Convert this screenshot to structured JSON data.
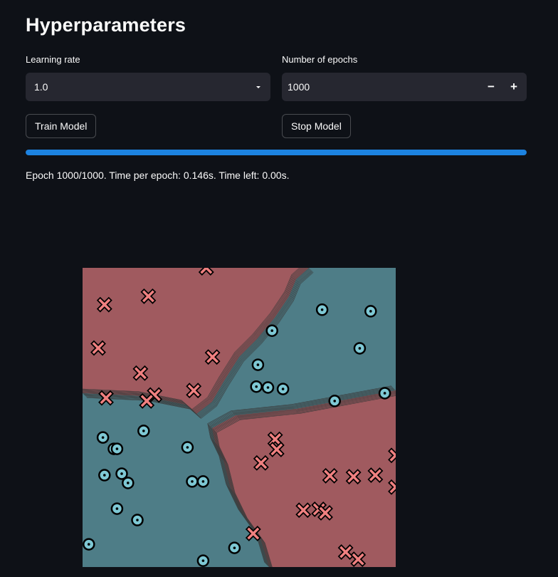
{
  "page": {
    "title": "Hyperparameters"
  },
  "controls": {
    "learning_rate": {
      "label": "Learning rate",
      "value": "1.0"
    },
    "epochs": {
      "label": "Number of epochs",
      "value": "1000",
      "decrement": "−",
      "increment": "+"
    },
    "train_button": "Train Model",
    "stop_button": "Stop Model"
  },
  "progress": {
    "fraction": 1.0
  },
  "status_text": "Epoch 1000/1000. Time per epoch: 0.146s. Time left: 0.00s.",
  "colors": {
    "background": "#0e1117",
    "widget": "#262730",
    "accent": "#1c83e1",
    "region_red": "#a05a5f",
    "region_teal": "#4e7d87",
    "marker_x": "#f08080",
    "marker_o": "#7ec8d4"
  },
  "chart_data": {
    "type": "scatter",
    "title": "",
    "xlabel": "",
    "ylabel": "",
    "xlim": [
      0,
      1
    ],
    "ylim": [
      0,
      1
    ],
    "grid": false,
    "legend": "none",
    "series": [
      {
        "marker": "x",
        "color": "#f08080",
        "points": [
          [
            0.395,
            1.0
          ],
          [
            0.07,
            0.877
          ],
          [
            0.21,
            0.905
          ],
          [
            0.05,
            0.732
          ],
          [
            0.185,
            0.648
          ],
          [
            0.415,
            0.702
          ],
          [
            0.075,
            0.565
          ],
          [
            0.23,
            0.575
          ],
          [
            0.205,
            0.555
          ],
          [
            0.355,
            0.59
          ],
          [
            0.615,
            0.427
          ],
          [
            0.62,
            0.393
          ],
          [
            0.57,
            0.348
          ],
          [
            0.79,
            0.305
          ],
          [
            0.865,
            0.302
          ],
          [
            0.935,
            0.307
          ],
          [
            1.0,
            0.373
          ],
          [
            1.0,
            0.267
          ],
          [
            0.705,
            0.19
          ],
          [
            0.755,
            0.193
          ],
          [
            0.775,
            0.181
          ],
          [
            0.545,
            0.112
          ],
          [
            0.84,
            0.05
          ],
          [
            0.88,
            0.026
          ]
        ]
      },
      {
        "marker": "o",
        "color": "#7ec8d4",
        "points": [
          [
            0.765,
            0.86
          ],
          [
            0.92,
            0.855
          ],
          [
            0.605,
            0.79
          ],
          [
            0.885,
            0.731
          ],
          [
            0.56,
            0.676
          ],
          [
            0.555,
            0.603
          ],
          [
            0.592,
            0.6
          ],
          [
            0.64,
            0.595
          ],
          [
            0.805,
            0.555
          ],
          [
            0.965,
            0.581
          ],
          [
            0.195,
            0.455
          ],
          [
            0.065,
            0.433
          ],
          [
            0.1,
            0.395
          ],
          [
            0.11,
            0.395
          ],
          [
            0.335,
            0.4
          ],
          [
            0.07,
            0.307
          ],
          [
            0.125,
            0.312
          ],
          [
            0.145,
            0.281
          ],
          [
            0.35,
            0.286
          ],
          [
            0.385,
            0.286
          ],
          [
            0.11,
            0.195
          ],
          [
            0.175,
            0.157
          ],
          [
            0.02,
            0.076
          ],
          [
            0.485,
            0.064
          ],
          [
            0.385,
            0.021
          ]
        ]
      }
    ]
  }
}
